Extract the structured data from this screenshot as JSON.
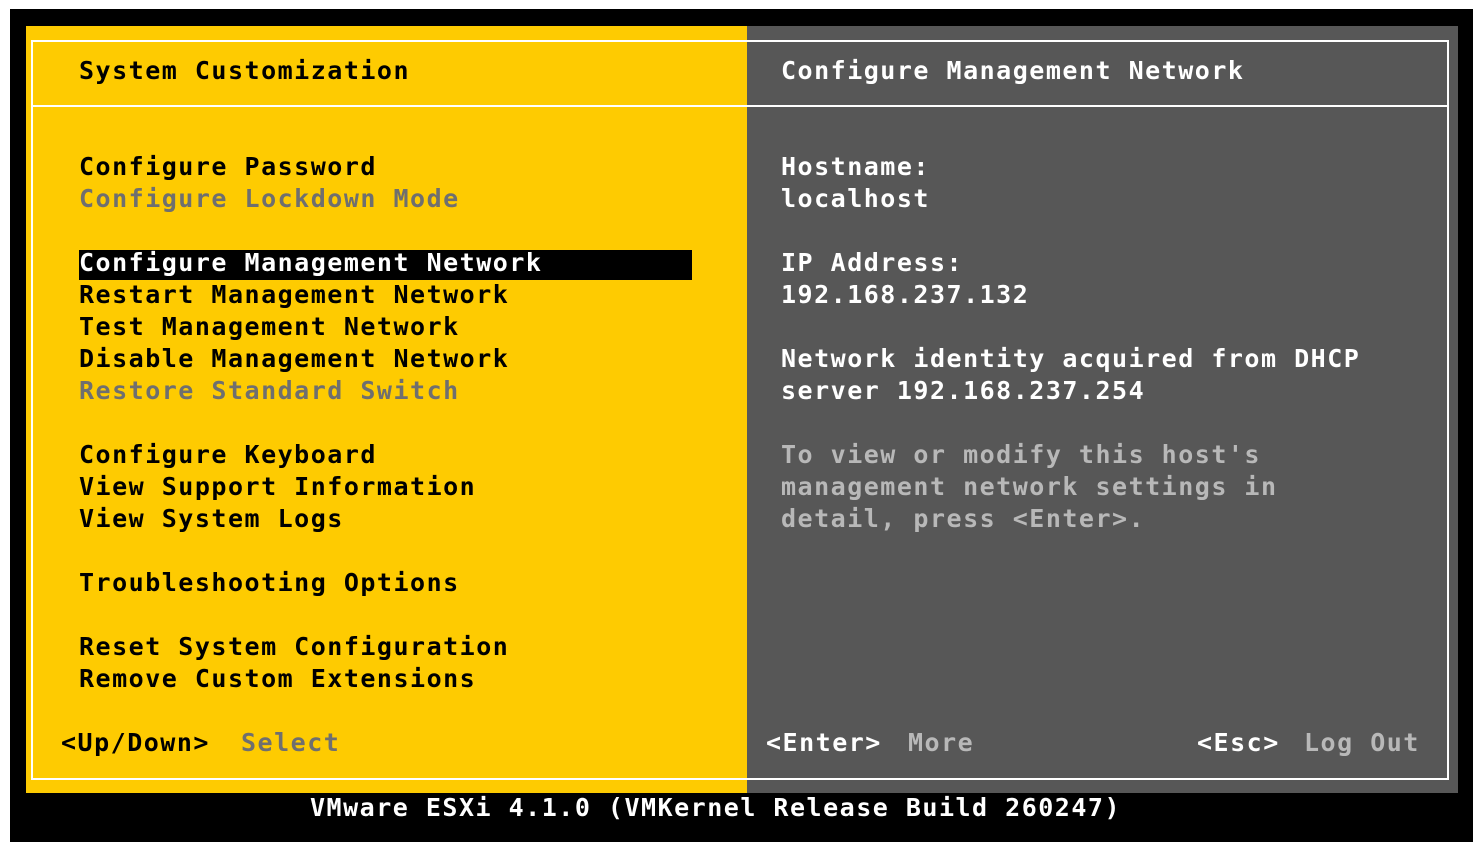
{
  "left": {
    "title": "System Customization",
    "menu": [
      {
        "label": "Configure Password",
        "enabled": true
      },
      {
        "label": "Configure Lockdown Mode",
        "enabled": false
      },
      {
        "label": "Configure Management Network",
        "enabled": true,
        "selected": true
      },
      {
        "label": "Restart Management Network",
        "enabled": true
      },
      {
        "label": "Test Management Network",
        "enabled": true
      },
      {
        "label": "Disable Management Network",
        "enabled": true
      },
      {
        "label": "Restore Standard Switch",
        "enabled": false
      },
      {
        "label": "Configure Keyboard",
        "enabled": true
      },
      {
        "label": "View Support Information",
        "enabled": true
      },
      {
        "label": "View System Logs",
        "enabled": true
      },
      {
        "label": "Troubleshooting Options",
        "enabled": true
      },
      {
        "label": "Reset System Configuration",
        "enabled": true
      },
      {
        "label": "Remove Custom Extensions",
        "enabled": true
      }
    ],
    "hint_key": "<Up/Down>",
    "hint_action": "Select"
  },
  "right": {
    "title": "Configure Management Network",
    "hostname_label": "Hostname:",
    "hostname_value": "localhost",
    "ip_label": "IP Address:",
    "ip_value": "192.168.237.132",
    "dhcp_line1": "Network identity acquired from DHCP",
    "dhcp_line2": "server 192.168.237.254",
    "help_line1": "To view or modify this host's",
    "help_line2": "management network settings in",
    "help_line3": "detail, press <Enter>.",
    "enter_key": "<Enter>",
    "enter_action": "More",
    "esc_key": "<Esc>",
    "esc_action": "Log Out"
  },
  "footer": "VMware ESXi 4.1.0 (VMKernel Release Build 260247)",
  "colors": {
    "left_bg": "#fecb01",
    "right_bg": "#575757",
    "screen_bg": "#000000",
    "selection_bg": "#000000",
    "dim_text": "#6f6f6f"
  }
}
